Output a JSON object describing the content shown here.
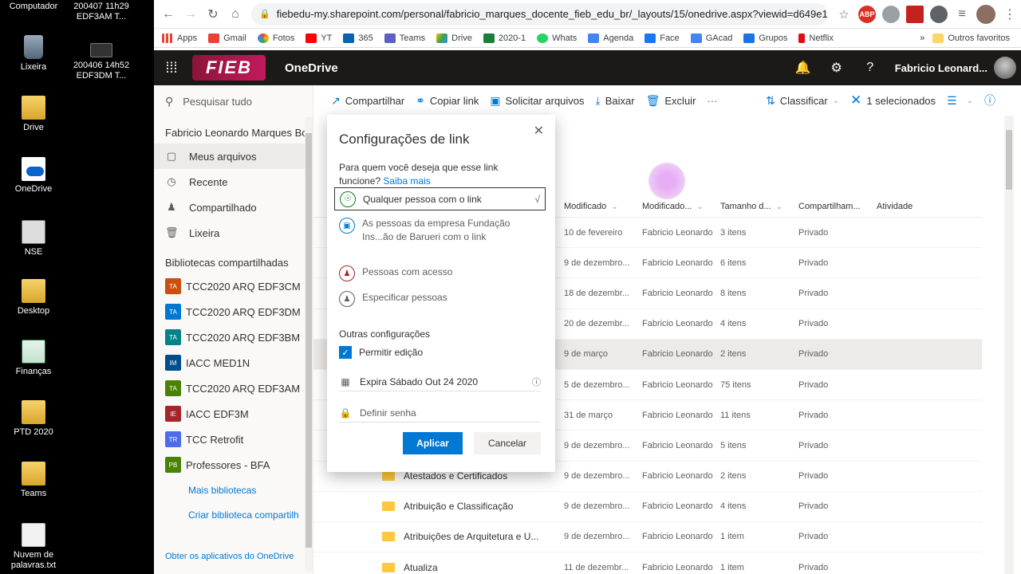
{
  "desktop": {
    "icons": [
      {
        "label": "Computador"
      },
      {
        "label": "200407 11h29\nEDF3AM T..."
      },
      {
        "label": "Lixeira"
      },
      {
        "label": "200406 14h52\nEDF3DM T..."
      },
      {
        "label": "Drive"
      },
      {
        "label": "OneDrive"
      },
      {
        "label": "NSE"
      },
      {
        "label": "Desktop"
      },
      {
        "label": "Finanças"
      },
      {
        "label": "PTD 2020"
      },
      {
        "label": "Teams"
      },
      {
        "label": "Nuvem de\npalavras.txt"
      }
    ]
  },
  "browser": {
    "url": "fiebedu-my.sharepoint.com/personal/fabricio_marques_docente_fieb_edu_br/_layouts/15/onedrive.aspx?viewid=d649e1...",
    "bookmarks": [
      "Apps",
      "Gmail",
      "Fotos",
      "YT",
      "365",
      "Teams",
      "Drive",
      "2020-1",
      "Whats",
      "Agenda",
      "Face",
      "GAcad",
      "Grupos",
      "Netflix"
    ],
    "other_bookmarks": "Outros favoritos",
    "ext_abp": "ABP"
  },
  "header": {
    "logo": "FIEB",
    "app": "OneDrive",
    "user": "Fabricio Leonard..."
  },
  "leftnav": {
    "search": "Pesquisar tudo",
    "owner": "Fabricio Leonardo Marques Bo",
    "items": [
      "Meus arquivos",
      "Recente",
      "Compartilhado",
      "Lixeira"
    ],
    "libraries_title": "Bibliotecas compartilhadas",
    "libraries": [
      {
        "badge": "TA",
        "name": "TCC2020 ARQ EDF3CM",
        "color": "#ca5010"
      },
      {
        "badge": "TA",
        "name": "TCC2020 ARQ EDF3DM",
        "color": "#0078d4"
      },
      {
        "badge": "TA",
        "name": "TCC2020 ARQ EDF3BM",
        "color": "#038387"
      },
      {
        "badge": "IM",
        "name": "IACC MED1N",
        "color": "#004e8c"
      },
      {
        "badge": "TA",
        "name": "TCC2020 ARQ EDF3AM",
        "color": "#498205"
      },
      {
        "badge": "IE",
        "name": "IACC EDF3M",
        "color": "#a4262c"
      },
      {
        "badge": "TR",
        "name": "TCC Retrofit",
        "color": "#4f6bed"
      },
      {
        "badge": "PB",
        "name": "Professores - BFA",
        "color": "#498205"
      }
    ],
    "more_libraries": "Mais bibliotecas",
    "create_library": "Criar biblioteca compartilh",
    "footer": "Obter os aplicativos do OneDrive"
  },
  "commandbar": {
    "share": "Compartilhar",
    "copy_link": "Copiar link",
    "request_files": "Solicitar arquivos",
    "download": "Baixar",
    "delete": "Excluir",
    "more": "···",
    "sort": "Classificar",
    "selected": "1 selecionados"
  },
  "table": {
    "columns": [
      "Modificado",
      "Modificado...",
      "Tamanho d...",
      "Compartilham...",
      "Atividade"
    ],
    "rows": [
      {
        "name": "",
        "modified": "10 de fevereiro",
        "by": "Fabricio Leonardo",
        "size": "3 itens",
        "sharing": "Privado"
      },
      {
        "name": "",
        "modified": "9 de dezembro...",
        "by": "Fabricio Leonardo",
        "size": "6 itens",
        "sharing": "Privado"
      },
      {
        "name": "",
        "modified": "18 de dezembr...",
        "by": "Fabricio Leonardo",
        "size": "8 itens",
        "sharing": "Privado"
      },
      {
        "name": "",
        "modified": "20 de dezembr...",
        "by": "Fabricio Leonardo",
        "size": "4 itens",
        "sharing": "Privado"
      },
      {
        "name": "",
        "modified": "9 de março",
        "by": "Fabricio Leonardo",
        "size": "2 itens",
        "sharing": "Privado"
      },
      {
        "name": "",
        "modified": "5 de dezembro...",
        "by": "Fabricio Leonardo",
        "size": "75 itens",
        "sharing": "Privado"
      },
      {
        "name": "",
        "modified": "31 de março",
        "by": "Fabricio Leonardo",
        "size": "11 itens",
        "sharing": "Privado"
      },
      {
        "name": "",
        "modified": "9 de dezembro...",
        "by": "Fabricio Leonardo",
        "size": "5 itens",
        "sharing": "Privado"
      },
      {
        "name": "Atestados e Certificados",
        "modified": "9 de dezembro...",
        "by": "Fabricio Leonardo",
        "size": "2 itens",
        "sharing": "Privado"
      },
      {
        "name": "Atribuição e Classificação",
        "modified": "9 de dezembro...",
        "by": "Fabricio Leonardo",
        "size": "4 itens",
        "sharing": "Privado"
      },
      {
        "name": "Atribuições de Arquitetura e U...",
        "modified": "9 de dezembro...",
        "by": "Fabricio Leonardo",
        "size": "1 item",
        "sharing": "Privado"
      },
      {
        "name": "Atualiza",
        "modified": "11 de dezembr...",
        "by": "Fabricio Leonardo",
        "size": "1 item",
        "sharing": "Privado"
      }
    ],
    "selected_row": 4
  },
  "dialog": {
    "title": "Configurações de link",
    "question": "Para quem você deseja que esse link funcione?",
    "learn_more": "Saiba mais",
    "selected_option": "Qualquer pessoa com o link",
    "options": [
      "As pessoas da empresa Fundação Ins...ão de Barueri com o link",
      "Pessoas com acesso",
      "Especificar pessoas"
    ],
    "other_settings": "Outras configurações",
    "allow_edit": "Permitir edição",
    "expires": "Expira Sábado Out 24 2020",
    "password": "Definir senha",
    "apply": "Aplicar",
    "cancel": "Cancelar"
  }
}
